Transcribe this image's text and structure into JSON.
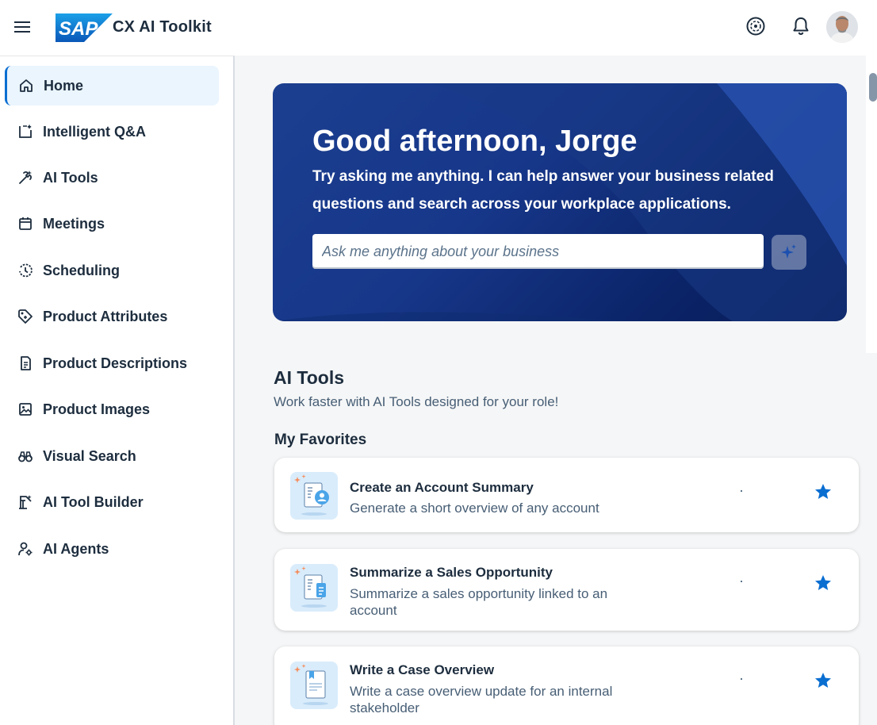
{
  "header": {
    "logo_text": "SAP",
    "app_title": "CX AI Toolkit",
    "icons": [
      "menu-icon",
      "ai-assist-icon",
      "notification-bell-icon",
      "user-avatar"
    ]
  },
  "sidebar": {
    "items": [
      {
        "label": "Home",
        "icon": "home-icon",
        "active": true
      },
      {
        "label": "Intelligent Q&A",
        "icon": "qa-icon",
        "active": false
      },
      {
        "label": "AI Tools",
        "icon": "tools-icon",
        "active": false
      },
      {
        "label": "Meetings",
        "icon": "calendar-icon",
        "active": false
      },
      {
        "label": "Scheduling",
        "icon": "history-icon",
        "active": false
      },
      {
        "label": "Product Attributes",
        "icon": "tag-icon",
        "active": false
      },
      {
        "label": "Product Descriptions",
        "icon": "document-icon",
        "active": false
      },
      {
        "label": "Product Images",
        "icon": "image-icon",
        "active": false
      },
      {
        "label": "Visual Search",
        "icon": "binoculars-icon",
        "active": false
      },
      {
        "label": "AI Tool Builder",
        "icon": "builder-icon",
        "active": false
      },
      {
        "label": "AI Agents",
        "icon": "agent-icon",
        "active": false
      }
    ]
  },
  "hero": {
    "greeting": "Good afternoon, Jorge",
    "subtitle": "Try asking me anything. I can help answer your business related questions and search across your workplace applications.",
    "input_placeholder": "Ask me anything about your business"
  },
  "ai_tools": {
    "title": "AI Tools",
    "subtitle": "Work faster with AI Tools designed for your role!",
    "favorites_title": "My Favorites",
    "cards": [
      {
        "title": "Create an Account Summary",
        "description": "Generate a short overview of any account",
        "favorite": true
      },
      {
        "title": "Summarize a Sales Opportunity",
        "description": "Summarize a sales opportunity linked to an account",
        "favorite": true
      },
      {
        "title": "Write a Case Overview",
        "description": "Write a case overview update for an internal stakeholder",
        "favorite": true
      }
    ]
  },
  "colors": {
    "accent": "#0a6ed1",
    "hero_dark": "#081b55",
    "hero_light": "#1c3f8f",
    "text": "#1d2d3e",
    "text_secondary": "#475e75",
    "star": "#0a6ed1",
    "sparkle": "#f58b5a"
  }
}
